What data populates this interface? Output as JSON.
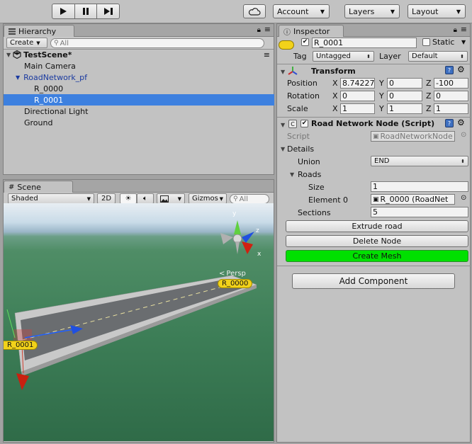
{
  "toolbar": {
    "play_icon": "play-icon",
    "pause_icon": "pause-icon",
    "step_icon": "step-icon",
    "cloud_icon": "cloud-icon",
    "account": "Account",
    "layers": "Layers",
    "layout": "Layout"
  },
  "hierarchy": {
    "tab": "Hierarchy",
    "create": "Create",
    "search_placeholder": "All",
    "scene_name": "TestScene*",
    "items": [
      {
        "label": "Main Camera"
      },
      {
        "label": "RoadNetwork_pf"
      },
      {
        "label": "R_0000"
      },
      {
        "label": "R_0001"
      },
      {
        "label": "Directional Light"
      },
      {
        "label": "Ground"
      }
    ]
  },
  "scene": {
    "tab": "Scene",
    "shading": "Shaded",
    "mode_2d": "2D",
    "gizmos": "Gizmos",
    "search_placeholder": "All",
    "persp": "Persp",
    "axis_y": "y",
    "axis_z": "z",
    "axis_x": "x",
    "label_r0000": "R_0000",
    "label_r0001": "R_0001"
  },
  "inspector": {
    "tab": "Inspector",
    "object_name": "R_0001",
    "static": "Static",
    "tag_label": "Tag",
    "tag_value": "Untagged",
    "layer_label": "Layer",
    "layer_value": "Default",
    "transform": {
      "title": "Transform",
      "position": {
        "label": "Position",
        "x": "8.74227",
        "y": "0",
        "z": "-100"
      },
      "rotation": {
        "label": "Rotation",
        "x": "0",
        "y": "0",
        "z": "0"
      },
      "scale": {
        "label": "Scale",
        "x": "1",
        "y": "1",
        "z": "1"
      },
      "x": "X",
      "y": "Y",
      "z": "Z"
    },
    "script_component": {
      "title": "Road Network Node (Script)",
      "script_label": "Script",
      "script_value": "RoadNetworkNode",
      "details": "Details",
      "union_label": "Union",
      "union_value": "END",
      "roads_label": "Roads",
      "size_label": "Size",
      "size_value": "1",
      "element0_label": "Element 0",
      "element0_value": "R_0000 (RoadNet",
      "sections_label": "Sections",
      "sections_value": "5"
    },
    "buttons": {
      "extrude": "Extrude road",
      "delete": "Delete Node",
      "create_mesh": "Create Mesh",
      "add_component": "Add Component"
    }
  },
  "colors": {
    "selection": "#3d80df",
    "create_mesh": "#00e000",
    "label_yellow": "#f2d21a"
  }
}
